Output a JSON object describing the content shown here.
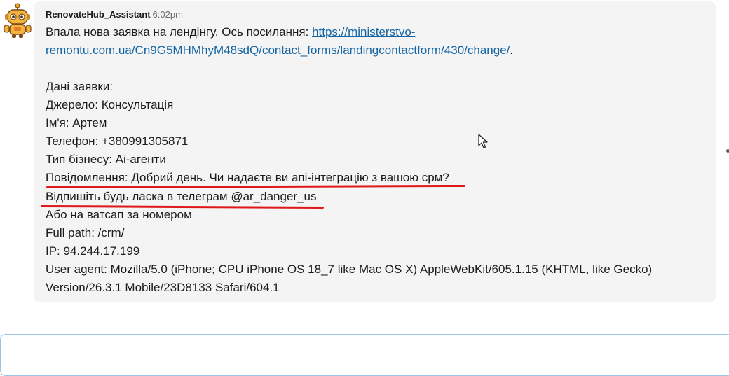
{
  "message": {
    "sender": "RenovateHub_Assistant",
    "time": "6:02pm",
    "avatar_icon": "robot-icon",
    "intro_text": "Впала нова заявка на лендінгу. Ось посилання: ",
    "link_part1": "https://ministerstvo-",
    "link_part2": "remontu.com.ua/Cn9G5MHMhyM48sdQ/contact_forms/landingcontactform/430/change/",
    "link_suffix": ".",
    "lines": [
      "Дані заявки:",
      "Джерело: Консультація",
      "Ім'я: Артем",
      "Телефон: +380991305871",
      "Тип бізнесу: Аі-агенти",
      "Повідомлення: Добрий день. Чи надаєте ви апі-інтеграцію з вашою срм?",
      "Відпишіть будь ласка в телеграм @ar_danger_us",
      "Або на ватсап за номером",
      "Full path: /crm/",
      "IP: 94.244.17.199",
      "User agent: Mozilla/5.0 (iPhone; CPU iPhone OS 18_7 like Mac OS X) AppleWebKit/605.1.15 (KHTML, like Gecko)",
      "Version/26.3.1 Mobile/23D8133 Safari/604.1"
    ]
  },
  "colors": {
    "link": "#1264a3",
    "annotation_underline": "#e0181c",
    "bubble_background": "#f4f4f4",
    "composer_border": "#9fc3e6"
  }
}
